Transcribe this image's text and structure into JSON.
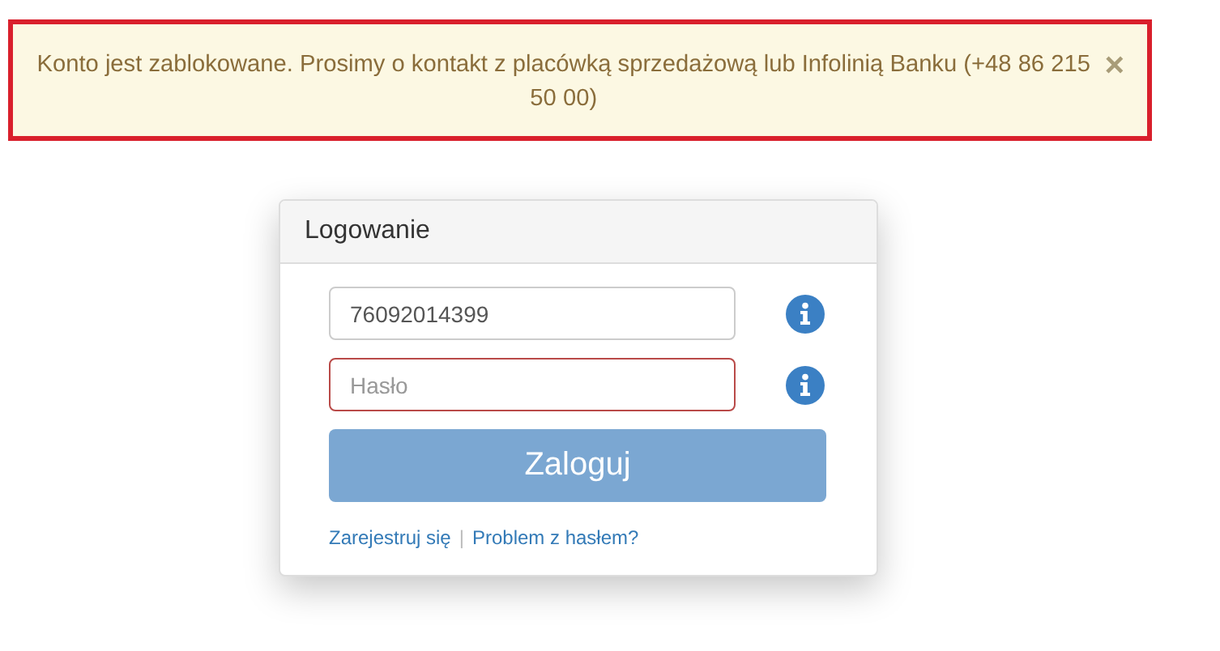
{
  "alert": {
    "message": "Konto jest zablokowane. Prosimy o kontakt z placówką sprzedażową lub Infolinią Banku (+48 86 215 50 00)",
    "close": "×"
  },
  "login": {
    "title": "Logowanie",
    "fields": [
      {
        "value": "76092014399",
        "invalid": false
      },
      {
        "placeholder": "Hasło",
        "invalid": true
      }
    ],
    "submit": {
      "label": "Zaloguj",
      "disabled": true
    },
    "links": [
      "Zarejestruj się",
      "Problem z hasłem?"
    ],
    "separator": "|"
  }
}
